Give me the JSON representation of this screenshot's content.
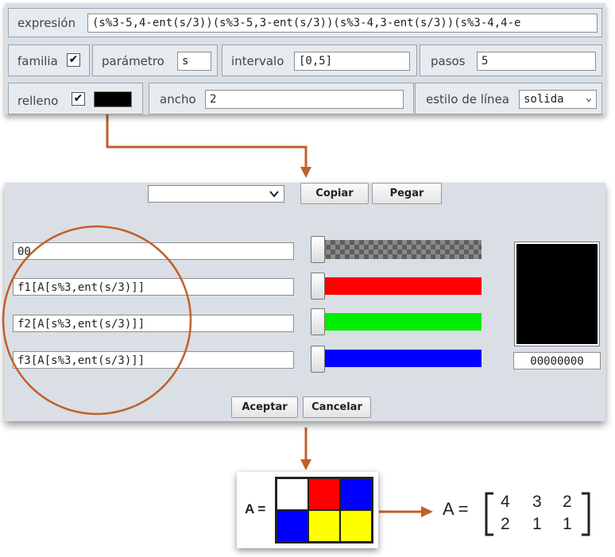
{
  "top_panel": {
    "expresion_label": "expresión",
    "expresion_value": "(s%3-5,4-ent(s/3))(s%3-5,3-ent(s/3))(s%3-4,3-ent(s/3))(s%3-4,4-e",
    "familia_label": "familia",
    "familia_checked": "✔",
    "parametro_label": "parámetro",
    "parametro_value": "s",
    "intervalo_label": "intervalo",
    "intervalo_value": "[0,5]",
    "pasos_label": "pasos",
    "pasos_value": "5",
    "relleno_label": "relleno",
    "relleno_checked": "✔",
    "relleno_color": "#000000",
    "ancho_label": "ancho",
    "ancho_value": "2",
    "estilo_label": "estilo de línea",
    "estilo_value": "solida"
  },
  "color_dialog": {
    "dropdown_value": "",
    "copy_label": "Copiar",
    "paste_label": "Pegar",
    "channels": [
      {
        "expr": "00",
        "color": "transparent"
      },
      {
        "expr": "f1[A[s%3,ent(s/3)]]",
        "color": "#ff0000"
      },
      {
        "expr": "f2[A[s%3,ent(s/3)]]",
        "color": "#00ee00"
      },
      {
        "expr": "f3[A[s%3,ent(s/3)]]",
        "color": "#0000ff"
      }
    ],
    "preview_color": "#000000",
    "hex_value": "00000000",
    "accept_label": "Aceptar",
    "cancel_label": "Cancelar"
  },
  "matrix": {
    "label": "A =",
    "colors": [
      [
        "#ffffff",
        "#ff0000",
        "#0000ff"
      ],
      [
        "#0000ff",
        "#ffff00",
        "#ffff00"
      ]
    ],
    "result_label": "A =",
    "values": [
      [
        "4",
        "3",
        "2"
      ],
      [
        "2",
        "1",
        "1"
      ]
    ]
  },
  "accent_color": "#c0602a"
}
